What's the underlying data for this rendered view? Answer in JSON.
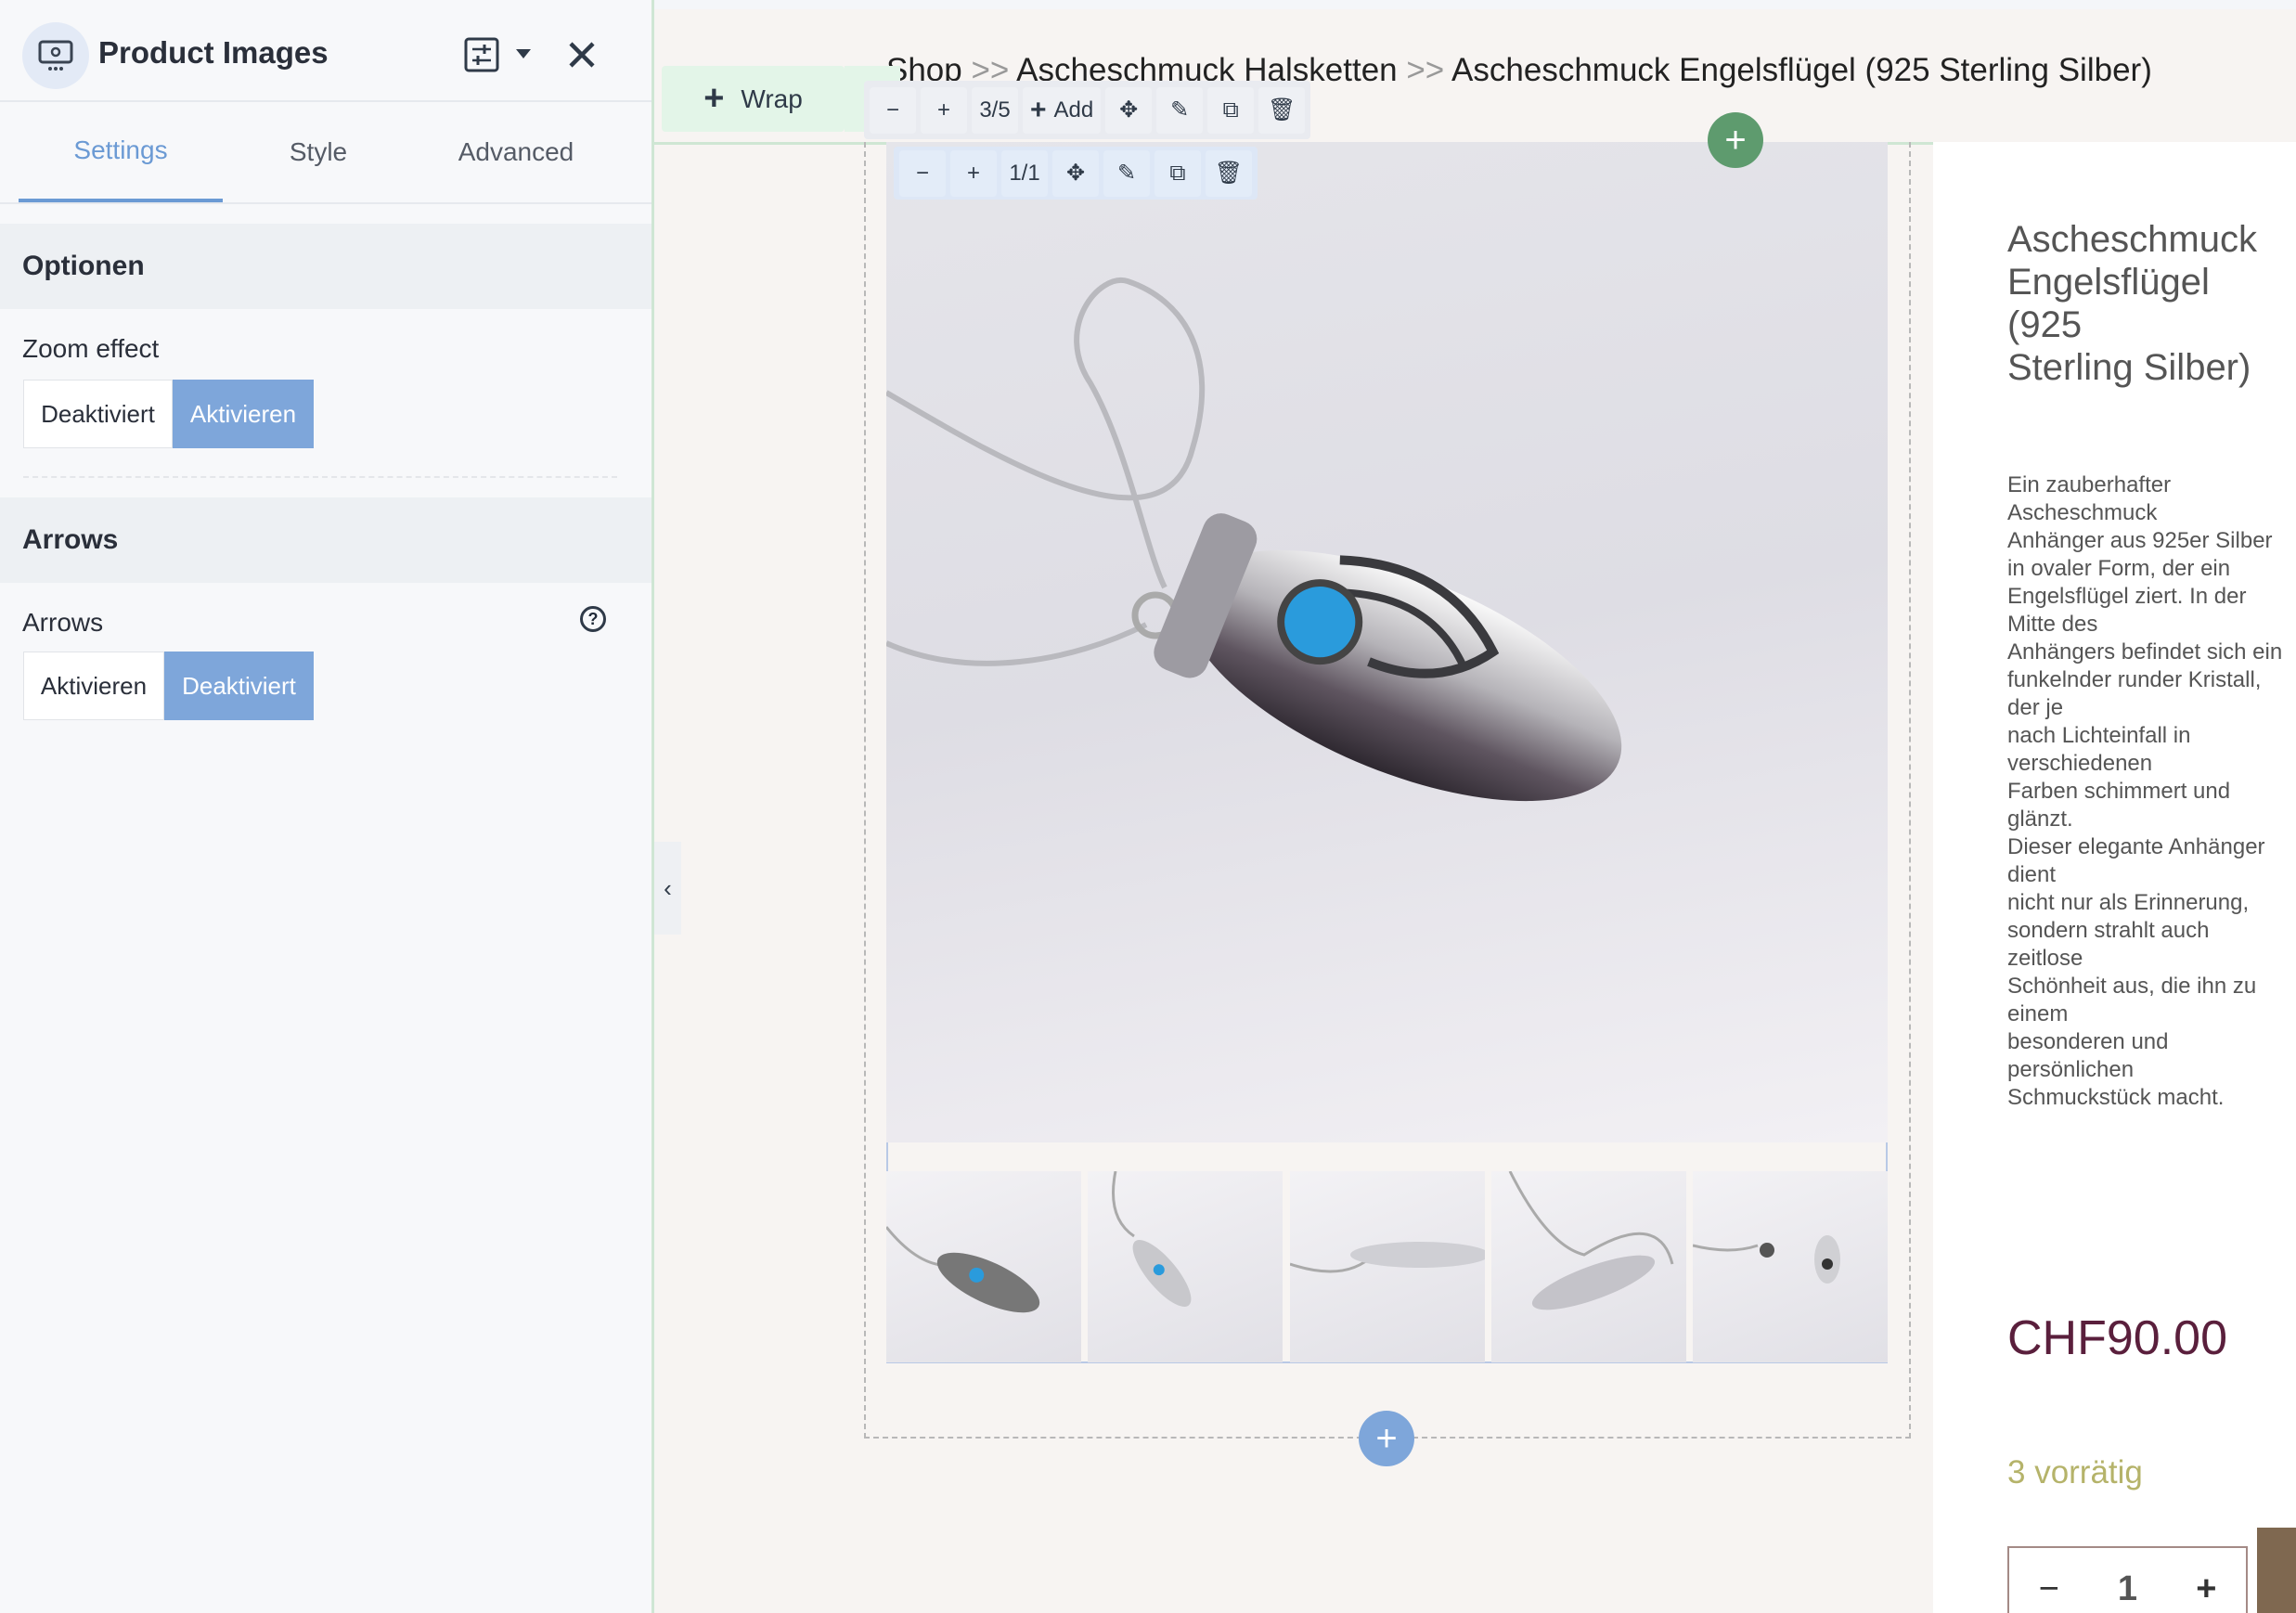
{
  "panel": {
    "title": "Product Images",
    "tabs": [
      "Settings",
      "Style",
      "Advanced"
    ],
    "active_tab": "Settings",
    "sections": [
      {
        "title": "Optionen",
        "field_label": "Zoom effect",
        "options": [
          "Deaktiviert",
          "Aktivieren"
        ],
        "selected": "Aktivieren"
      },
      {
        "title": "Arrows",
        "field_label": "Arrows",
        "options": [
          "Aktivieren",
          "Deaktiviert"
        ],
        "selected": "Deaktiviert"
      }
    ]
  },
  "canvas": {
    "wrap_label": "Wrap",
    "toolbar1": {
      "counter": "3/5",
      "add_label": "Add"
    },
    "toolbar2": {
      "counter": "1/1"
    },
    "breadcrumb": {
      "first": "Shop",
      "second": "Ascheschmuck Halsketten",
      "sep": ">>",
      "current": "Ascheschmuck Engelsflügel (925 Sterling Silber)"
    },
    "accent_green": "#5e9b6e",
    "accent_blue": "#7ea6da"
  },
  "product": {
    "title_lines": [
      "Ascheschmuck",
      "Engelsflügel (925",
      "Sterling Silber)"
    ],
    "description_lines": [
      "Ein zauberhafter Ascheschmuck",
      "Anhänger aus 925er Silber",
      "in ovaler Form, der ein",
      "Engelsflügel ziert. In der Mitte des",
      "Anhängers befindet sich ein",
      "funkelnder runder Kristall, der je",
      "nach Lichteinfall in verschiedenen",
      "Farben schimmert und glänzt.",
      "Dieser elegante Anhänger dient",
      "nicht nur als Erinnerung,",
      "sondern strahlt auch zeitlose",
      "Schönheit aus, die ihn zu einem",
      "besonderen und persönlichen",
      "Schmuckstück macht."
    ],
    "price": "CHF90.00",
    "stock": "3 vorrätig",
    "quantity": "1"
  }
}
